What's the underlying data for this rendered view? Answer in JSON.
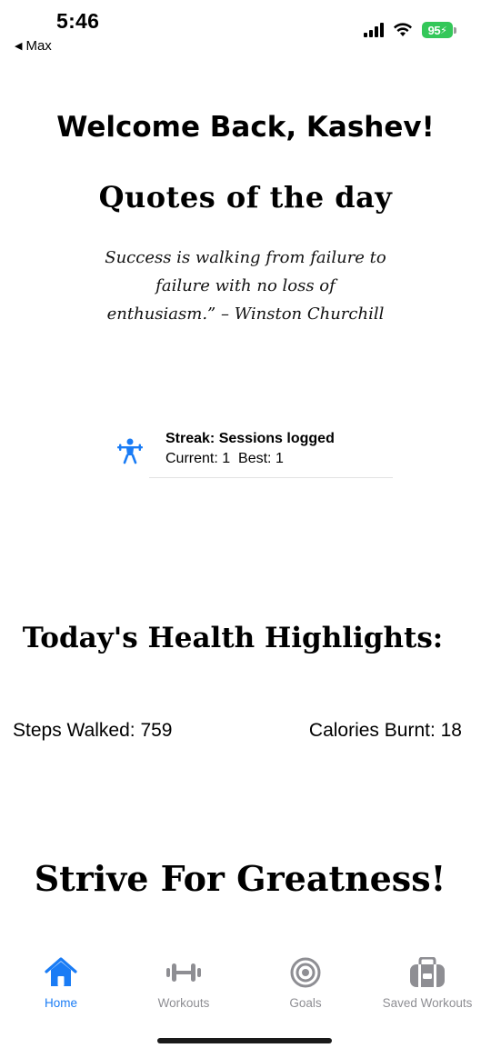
{
  "status_bar": {
    "time": "5:46",
    "back_label": "Max",
    "battery": "95"
  },
  "home": {
    "welcome": "Welcome Back, Kashev!",
    "quotes_title": "Quotes of the day",
    "quote": "Success is walking from failure to failure with no loss of enthusiasm.” – Winston Churchill",
    "streak": {
      "icon": "weightlifter-icon",
      "title": "Streak: Sessions logged",
      "detail": "Current: 1  Best: 1"
    },
    "health_title": "Today's Health Highlights:",
    "steps": "Steps Walked: 759",
    "calories": "Calories Burnt: 18",
    "motto": "Strive For Greatness!"
  },
  "tabbar": {
    "items": [
      {
        "label": "Home",
        "icon": "house-icon",
        "active": true
      },
      {
        "label": "Workouts",
        "icon": "dumbbell-icon",
        "active": false
      },
      {
        "label": "Goals",
        "icon": "target-icon",
        "active": false
      },
      {
        "label": "Saved Workouts",
        "icon": "backpack-icon",
        "active": false
      }
    ]
  },
  "colors": {
    "accent": "#1a7cf5",
    "inactive": "#8e8e93",
    "battery": "#34c759"
  }
}
